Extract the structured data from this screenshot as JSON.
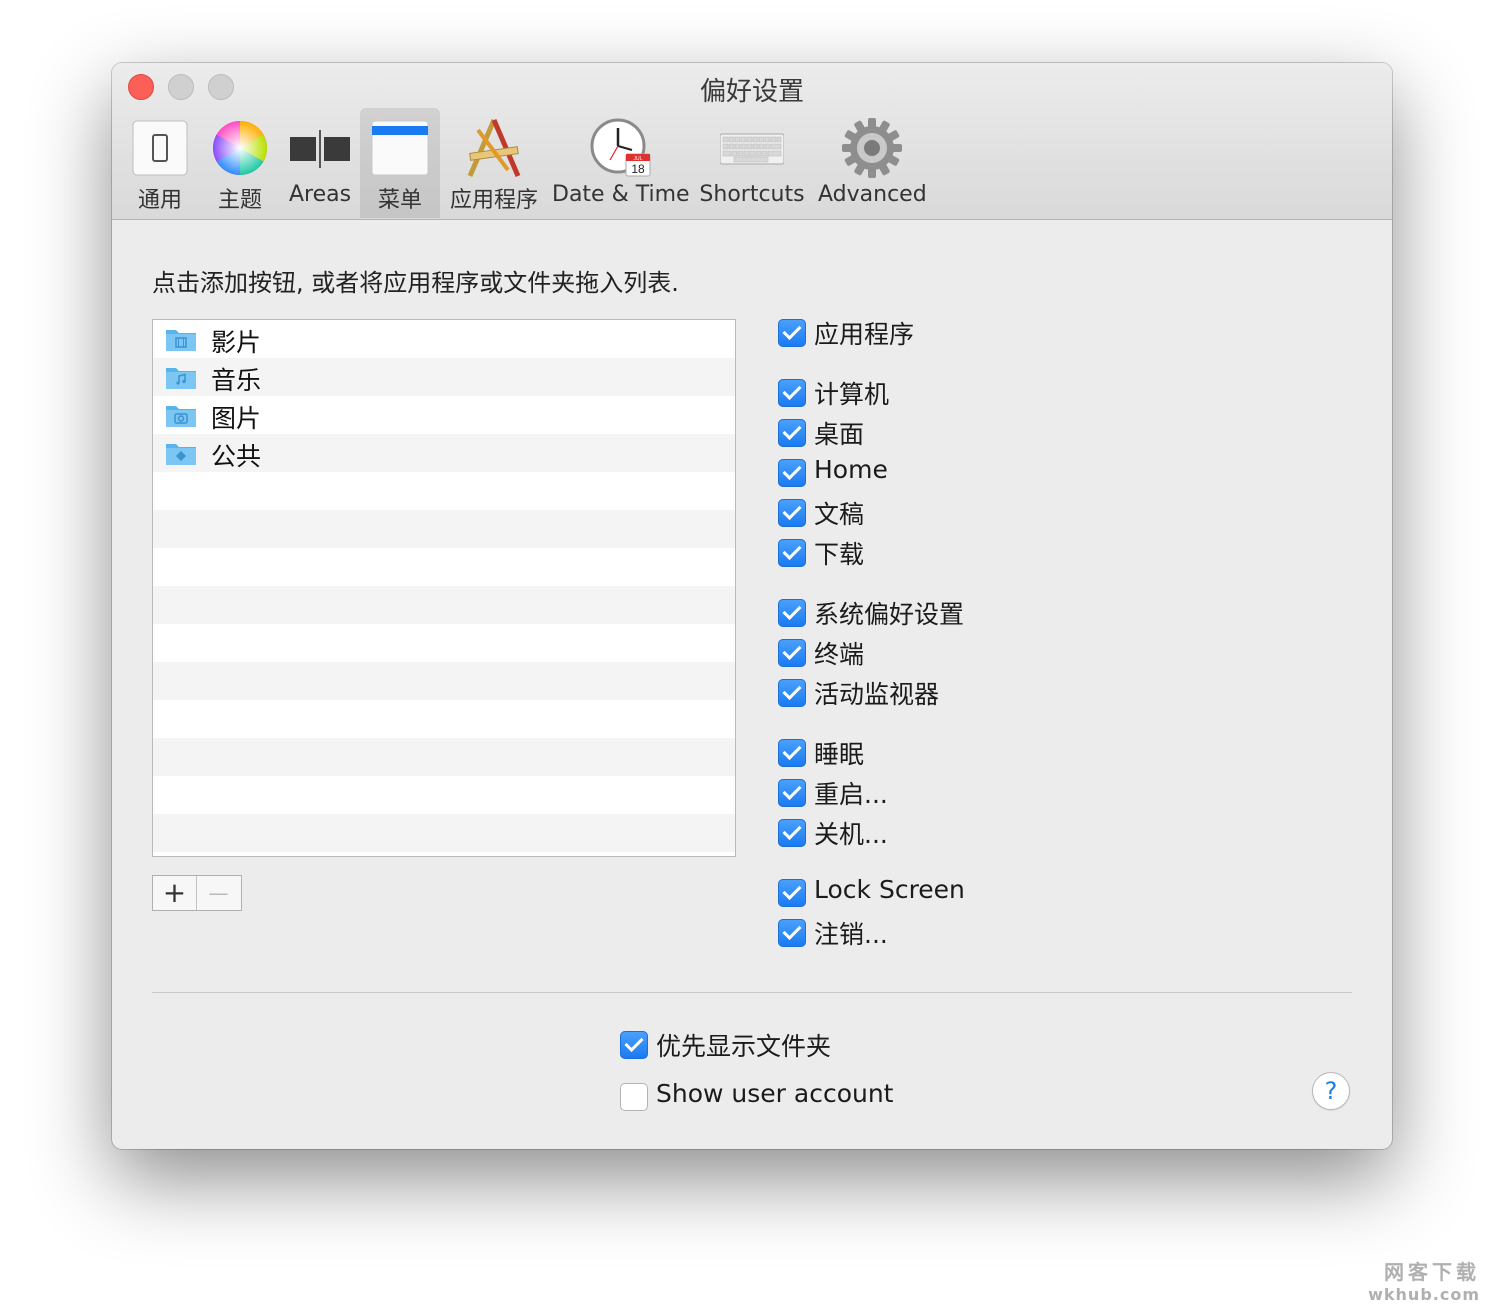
{
  "window": {
    "title": "偏好设置"
  },
  "toolbar": {
    "tabs": [
      {
        "label": "通用",
        "icon": "general-icon"
      },
      {
        "label": "主题",
        "icon": "color-wheel-icon"
      },
      {
        "label": "Areas",
        "icon": "areas-icon"
      },
      {
        "label": "菜单",
        "icon": "menu-icon",
        "selected": true
      },
      {
        "label": "应用程序",
        "icon": "applications-icon"
      },
      {
        "label": "Date & Time",
        "icon": "clock-icon"
      },
      {
        "label": "Shortcuts",
        "icon": "keyboard-icon"
      },
      {
        "label": "Advanced",
        "icon": "gear-icon"
      }
    ]
  },
  "main": {
    "instruction": "点击添加按钮, 或者将应用程序或文件夹拖入列表.",
    "list": [
      {
        "name": "影片",
        "icon": "movies-folder-icon"
      },
      {
        "name": "音乐",
        "icon": "music-folder-icon"
      },
      {
        "name": "图片",
        "icon": "pictures-folder-icon"
      },
      {
        "name": "公共",
        "icon": "public-folder-icon"
      }
    ],
    "add_button": "+",
    "remove_button": "—"
  },
  "options": [
    {
      "label": "应用程序",
      "checked": true
    },
    {
      "label": "计算机",
      "checked": true
    },
    {
      "label": "桌面",
      "checked": true
    },
    {
      "label": "Home",
      "checked": true
    },
    {
      "label": "文稿",
      "checked": true
    },
    {
      "label": "下载",
      "checked": true
    },
    {
      "label": "系统偏好设置",
      "checked": true
    },
    {
      "label": "终端",
      "checked": true
    },
    {
      "label": "活动监视器",
      "checked": true
    },
    {
      "label": "睡眠",
      "checked": true
    },
    {
      "label": "重启...",
      "checked": true
    },
    {
      "label": "关机...",
      "checked": true
    },
    {
      "label": "Lock Screen",
      "checked": true
    },
    {
      "label": "注销...",
      "checked": true
    }
  ],
  "bottom": {
    "folders_first": {
      "label": "优先显示文件夹",
      "checked": true
    },
    "show_user_account": {
      "label": "Show user account",
      "checked": false
    },
    "help": "?"
  },
  "watermark": {
    "line1": "网客下载",
    "line2": "wkhub.com"
  },
  "colors": {
    "accent": "#1a7af2",
    "close": "#fc5f57",
    "folder": "#5ab4ec"
  },
  "clock_icon": {
    "date_month": "JUL",
    "date_day": "18"
  }
}
